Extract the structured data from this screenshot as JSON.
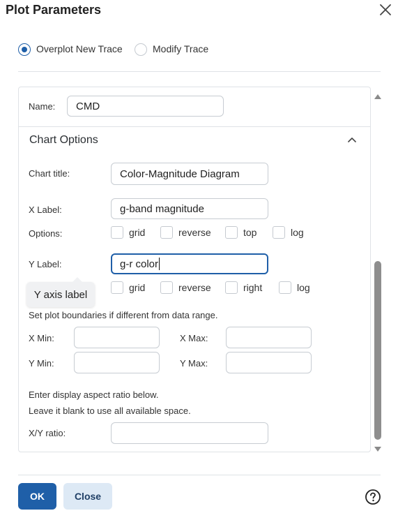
{
  "dialog": {
    "title": "Plot Parameters"
  },
  "trace_mode": {
    "options": [
      {
        "label": "Overplot New Trace",
        "selected": true
      },
      {
        "label": "Modify Trace",
        "selected": false
      }
    ]
  },
  "name_row": {
    "label": "Name:",
    "value": "CMD"
  },
  "chart_options": {
    "section_title": "Chart Options",
    "chart_title_label": "Chart title:",
    "chart_title_value": "Color-Magnitude Diagram",
    "x_label_label": "X Label:",
    "x_label_value": "g-band magnitude",
    "x_options_label": "Options:",
    "x_options": [
      "grid",
      "reverse",
      "top",
      "log"
    ],
    "y_label_label": "Y Label:",
    "y_label_value": "g-r color",
    "y_options": [
      "grid",
      "reverse",
      "right",
      "log"
    ],
    "y_tooltip": "Y axis label",
    "bounds_hint": "Set plot boundaries if different from data range.",
    "x_min_label": "X Min:",
    "x_max_label": "X Max:",
    "y_min_label": "Y Min:",
    "y_max_label": "Y Max:",
    "x_min_value": "",
    "x_max_value": "",
    "y_min_value": "",
    "y_max_value": "",
    "aspect_hint_1": "Enter display aspect ratio below.",
    "aspect_hint_2": "Leave it blank to use all available space.",
    "ratio_label": "X/Y ratio:",
    "ratio_value": ""
  },
  "footer": {
    "ok_label": "OK",
    "close_label": "Close"
  },
  "colors": {
    "accent": "#1f5fa8",
    "secondary_button_bg": "#dde9f5"
  },
  "icons": {
    "close": "close-icon",
    "collapse": "chevron-up-icon",
    "help": "help-circle-icon",
    "scroll_up": "triangle-up-icon",
    "scroll_down": "triangle-down-icon"
  }
}
